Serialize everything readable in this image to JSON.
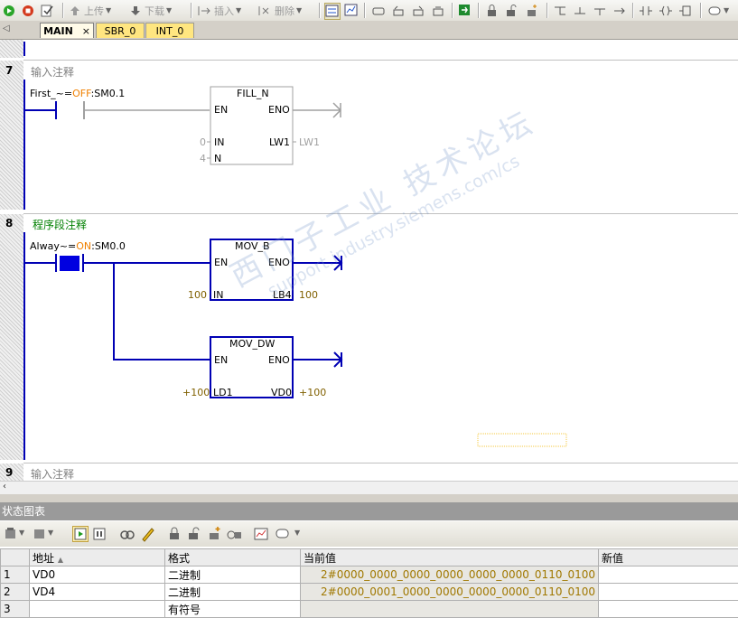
{
  "toolbar": {
    "upload_label": "上传",
    "download_label": "下载",
    "insert_label": "插入",
    "delete_label": "删除"
  },
  "tabs": [
    {
      "label": "MAIN",
      "close": "×"
    },
    {
      "label": "SBR_0"
    },
    {
      "label": "INT_0"
    }
  ],
  "networks": [
    {
      "number": "7",
      "comment": "输入注释",
      "contact_symbol": "First_~",
      "contact_eq": "=",
      "contact_state": "OFF",
      "contact_addr": ":SM0.1",
      "box": {
        "name": "FILL_N",
        "en": "EN",
        "eno": "ENO",
        "in_pin": "IN",
        "n_pin": "N",
        "out_pin": "LW1",
        "in_val": "0",
        "n_val": "4",
        "out_val": "LW1"
      }
    },
    {
      "number": "8",
      "comment": "程序段注释",
      "contact_symbol": "Alway~",
      "contact_eq": "=",
      "contact_state": "ON",
      "contact_addr": ":SM0.0",
      "box1": {
        "name": "MOV_B",
        "en": "EN",
        "eno": "ENO",
        "in_pin": "IN",
        "out_pin": "LB4",
        "in_val": "100",
        "out_val": "100"
      },
      "box2": {
        "name": "MOV_DW",
        "en": "EN",
        "eno": "ENO",
        "in_pin": "LD1",
        "out_pin": "VD0",
        "in_val": "+100",
        "out_val": "+100"
      }
    },
    {
      "number": "9",
      "comment": "输入注释"
    }
  ],
  "watermark": {
    "line1": "西门子工业  技术论坛",
    "line2": "support.industry.siemens.com/cs"
  },
  "status_chart": {
    "title": "状态图表",
    "columns": [
      "地址",
      "格式",
      "当前值",
      "新值"
    ],
    "sort_marker": "▲",
    "rows": [
      {
        "index": "1",
        "address": "VD0",
        "format": "二进制",
        "current": "2#0000_0000_0000_0000_0000_0000_0110_0100",
        "new": ""
      },
      {
        "index": "2",
        "address": "VD4",
        "format": "二进制",
        "current": "2#0000_0001_0000_0000_0000_0000_0110_0100",
        "new": ""
      },
      {
        "index": "3",
        "address": "",
        "format": "有符号",
        "current": "",
        "new": ""
      }
    ]
  },
  "colors": {
    "active_wire": "#0000b4",
    "inactive_wire": "#a0a0a0",
    "value_text": "#806000",
    "comment_green": "#008000",
    "status_on": "#f08000",
    "tab_yellow": "#ffe680",
    "tab_active": "#fffbe8"
  }
}
